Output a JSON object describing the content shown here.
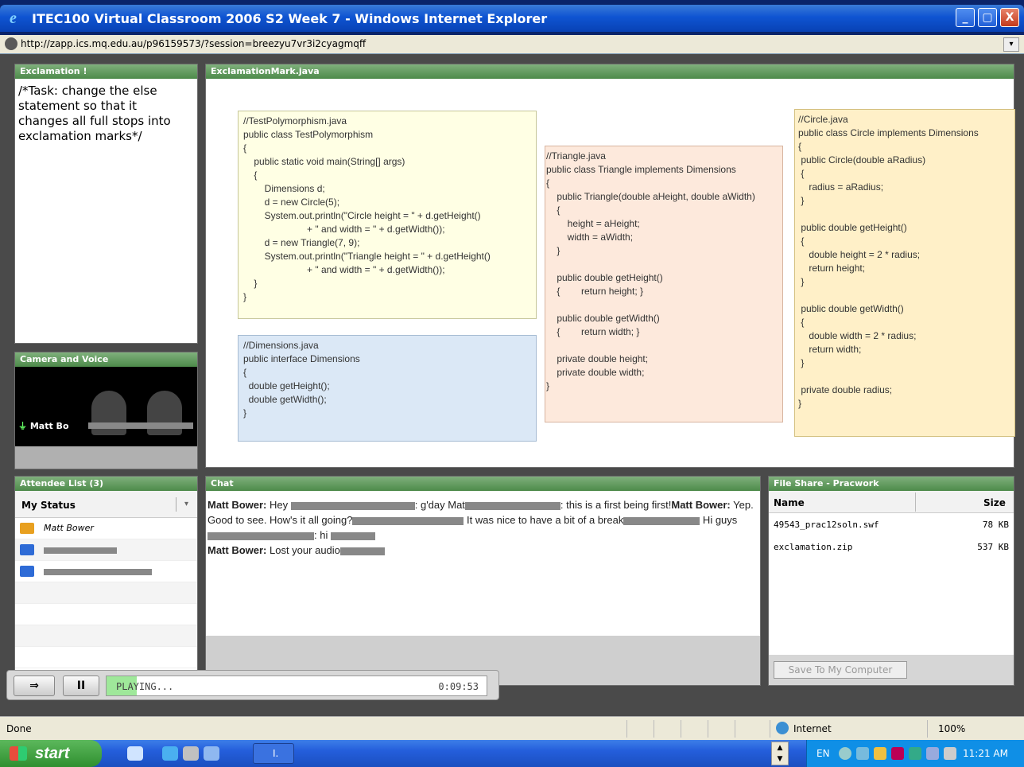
{
  "window": {
    "title": "ITEC100 Virtual Classroom 2006 S2 Week 7 - Windows Internet Explorer",
    "minimize": "_",
    "maximize": "▢",
    "close": "X"
  },
  "address": {
    "url": "http://zapp.ics.mq.edu.au/p96159573/?session=breezyu7vr3i2cyagmqff",
    "dropdown": "▾"
  },
  "exclamation": {
    "title": "Exclamation !",
    "text": "/*Task: change the else\nstatement so that it\nchanges all full stops into\nexclamation marks*/"
  },
  "camera": {
    "title": "Camera and Voice",
    "user": "Matt Bo"
  },
  "code": {
    "title": "ExclamationMark.java",
    "test": "//TestPolymorphism.java\npublic class TestPolymorphism\n{\n    public static void main(String[] args)\n    {\n        Dimensions d;\n        d = new Circle(5);\n        System.out.println(\"Circle height = \" + d.getHeight()\n                        + \" and width = \" + d.getWidth());\n        d = new Triangle(7, 9);\n        System.out.println(\"Triangle height = \" + d.getHeight()\n                        + \" and width = \" + d.getWidth());\n    }\n}",
    "dimensions": "//Dimensions.java\npublic interface Dimensions\n{\n  double getHeight();\n  double getWidth();\n}",
    "triangle": "//Triangle.java\npublic class Triangle implements Dimensions\n{\n    public Triangle(double aHeight, double aWidth)\n    {\n        height = aHeight;\n        width = aWidth;\n    }\n\n    public double getHeight()\n    {        return height; }\n\n    public double getWidth()\n    {        return width; }\n\n    private double height;\n    private double width;\n}",
    "circle": "//Circle.java\npublic class Circle implements Dimensions\n{\n public Circle(double aRadius)\n {\n    radius = aRadius;\n }\n\n public double getHeight()\n {\n    double height = 2 * radius;\n    return height;\n }\n\n public double getWidth()\n {\n    double width = 2 * radius;\n    return width;\n }\n\n private double radius;\n}"
  },
  "attendees": {
    "title": "Attendee List (3)",
    "status_label": "My Status",
    "rows": [
      {
        "name": "Matt Bower",
        "color": "#e8a020"
      },
      {
        "name": "",
        "color": "#2e6bd6"
      },
      {
        "name": "",
        "color": "#2e6bd6"
      }
    ]
  },
  "chat": {
    "title": "Chat",
    "messages": [
      {
        "sender": "Matt Bower:",
        "text": " Hey "
      },
      {
        "sender": "",
        "text": ": g'day Mat"
      },
      {
        "sender": "",
        "text": ": this is a first being first!"
      },
      {
        "sender": "Matt Bower:",
        "text": " Yep. Good to see. How's it all going?"
      },
      {
        "sender": "",
        "text": " It was nice to have a bit of a break"
      },
      {
        "sender": "",
        "text": " Hi guys"
      },
      {
        "sender": "",
        "text": ": hi "
      },
      {
        "sender": "Matt Bower:",
        "text": " Lost your audio"
      }
    ]
  },
  "files": {
    "title": "File Share - Pracwork",
    "col_name": "Name",
    "col_size": "Size",
    "rows": [
      {
        "name": "49543_prac12soln.swf",
        "size": "78 KB"
      },
      {
        "name": "exclamation.zip",
        "size": "537 KB"
      }
    ],
    "save": "Save To My Computer"
  },
  "player": {
    "status": "PLAYING...",
    "time": "0:09:53",
    "progress": 0.08,
    "pause": "II",
    "export": "⇒"
  },
  "statusbar": {
    "done": "Done",
    "zone": "Internet",
    "zoom": "100%"
  },
  "taskbar": {
    "start": "start",
    "task_ie": "I.",
    "lang": "EN",
    "time": "11:21 AM"
  }
}
